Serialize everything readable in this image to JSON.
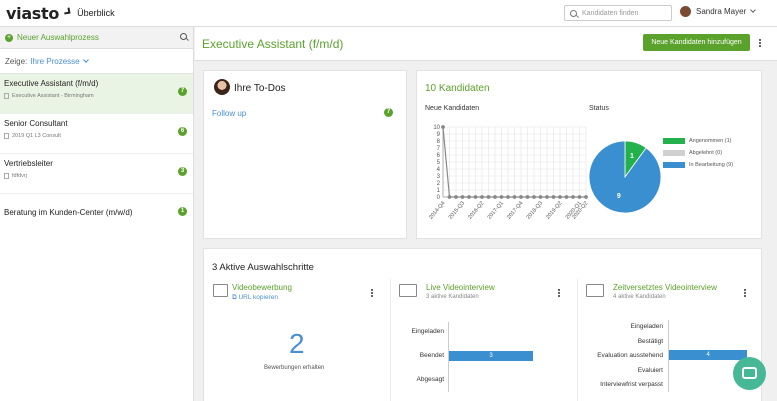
{
  "topbar": {
    "logo": "viasto",
    "nav": "Überblick",
    "search_placeholder": "Kandidaten finden",
    "user": "Sandra Mayer"
  },
  "sidebar": {
    "new_process": "Neuer Auswahlprozess",
    "filter_label": "Zeige:",
    "filter_value": "Ihre Prozesse",
    "processes": [
      {
        "title": "Executive Assistant (f/m/d)",
        "sub": "Executive Assistant - Birmingham",
        "count": "7"
      },
      {
        "title": "Senior Consultant",
        "sub": "2019 Q1 L3 Consult",
        "count": "6"
      },
      {
        "title": "Vertriebsleiter",
        "sub": "fdfdvrj",
        "count": "3"
      },
      {
        "title": "Beratung im Kunden-Center (m/w/d)",
        "sub": "",
        "count": "1"
      }
    ]
  },
  "main": {
    "title": "Executive Assistant (f/m/d)",
    "new_candidates_button": "Neue Kandidaten hinzufügen"
  },
  "todos": {
    "title": "Ihre To-Dos",
    "item": "Follow up",
    "count": "7"
  },
  "candidates": {
    "title": "10 Kandidaten",
    "new_label": "Neue Kandidaten",
    "status_label": "Status"
  },
  "chart_data": [
    {
      "type": "line",
      "title": "Neue Kandidaten",
      "x": [
        "2014-Q4",
        "2015-Q1",
        "2015-Q2",
        "2015-Q3",
        "2015-Q4",
        "2016-Q1",
        "2016-Q2",
        "2016-Q3",
        "2016-Q4",
        "2017-Q1",
        "2017-Q2",
        "2017-Q3",
        "2017-Q4",
        "2018-Q1",
        "2018-Q2",
        "2018-Q3",
        "2018-Q4",
        "2019-Q1",
        "2019-Q2",
        "2019-Q3",
        "2019-Q4",
        "2020-Q1",
        "2020-Q2"
      ],
      "tick_labels": [
        "2014-Q4",
        "2015-Q3",
        "2016-Q2",
        "2017-Q1",
        "2017-Q4",
        "2018-Q3",
        "2019-Q2",
        "2020-Q1",
        "2020-Q2"
      ],
      "y": [
        10,
        0,
        0,
        0,
        0,
        0,
        0,
        0,
        0,
        0,
        0,
        0,
        0,
        0,
        0,
        0,
        0,
        0,
        0,
        0,
        0,
        0,
        0
      ],
      "yticks": [
        "0",
        "1",
        "2",
        "3",
        "4",
        "5",
        "6",
        "7",
        "8",
        "9",
        "10"
      ],
      "ylim": [
        0,
        10
      ]
    },
    {
      "type": "pie",
      "title": "Status",
      "slices": [
        {
          "label": "Angenommen (1)",
          "value": 1,
          "color": "#22b14c"
        },
        {
          "label": "Abgelehnt (0)",
          "value": 0,
          "color": "#d0d0d0"
        },
        {
          "label": "In Bearbeitung (9)",
          "value": 9,
          "color": "#3a8fd0"
        }
      ]
    },
    {
      "type": "bar",
      "title": "Live Videointerview",
      "categories": [
        "Eingeladen",
        "Beendet",
        "Abgesagt"
      ],
      "values": [
        0,
        3,
        0
      ],
      "xlim": [
        0,
        4
      ]
    },
    {
      "type": "bar",
      "title": "Zeitversetztes Videointerview",
      "categories": [
        "Eingeladen",
        "Bestätigt",
        "Evaluation ausstehend",
        "Evaluiert",
        "Interviewfrist verpasst"
      ],
      "values": [
        0,
        0,
        4,
        0,
        0
      ],
      "xlim": [
        0,
        5
      ]
    }
  ],
  "steps": {
    "title": "3 Aktive Auswahlschritte",
    "video": {
      "name": "Videobewerbung",
      "link": "URL kopieren",
      "count": "2",
      "caption": "Bewerbungen erhalten"
    },
    "live": {
      "name": "Live Videointerview",
      "sub": "3 aktive Kandidaten"
    },
    "delayed": {
      "name": "Zeitversetztes Videointerview",
      "sub": "4 aktive Kandidaten"
    }
  }
}
